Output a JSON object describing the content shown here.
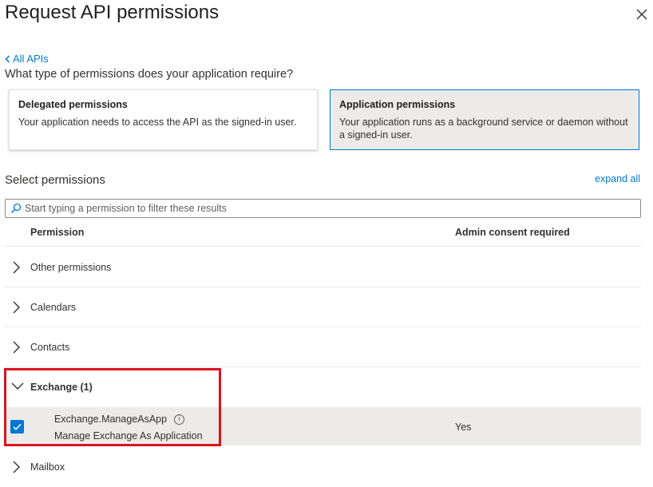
{
  "panel": {
    "title": "Request API permissions",
    "back_link": "All APIs",
    "question": "What type of permissions does your application require?"
  },
  "permission_types": {
    "delegated": {
      "title": "Delegated permissions",
      "description": "Your application needs to access the API as the signed-in user.",
      "selected": false
    },
    "application": {
      "title": "Application permissions",
      "description": "Your application runs as a background service or daemon without a signed-in user.",
      "selected": true
    }
  },
  "select": {
    "heading": "Select permissions",
    "expand_all": "expand all",
    "search_placeholder": "Start typing a permission to filter these results"
  },
  "table": {
    "col_permission": "Permission",
    "col_admin_consent": "Admin consent required",
    "groups": [
      {
        "label": "Other permissions",
        "expanded": false
      },
      {
        "label": "Calendars",
        "expanded": false
      },
      {
        "label": "Contacts",
        "expanded": false
      },
      {
        "label": "Exchange (1)",
        "expanded": true
      },
      {
        "label": "Mailbox",
        "expanded": false
      }
    ],
    "exchange_permission": {
      "name": "Exchange.ManageAsApp",
      "description": "Manage Exchange As Application",
      "admin_consent": "Yes",
      "checked": true,
      "info_icon": "i"
    }
  },
  "colors": {
    "accent": "#0078d4",
    "highlight": "#d9141e",
    "selected_bg": "#edebe9"
  }
}
